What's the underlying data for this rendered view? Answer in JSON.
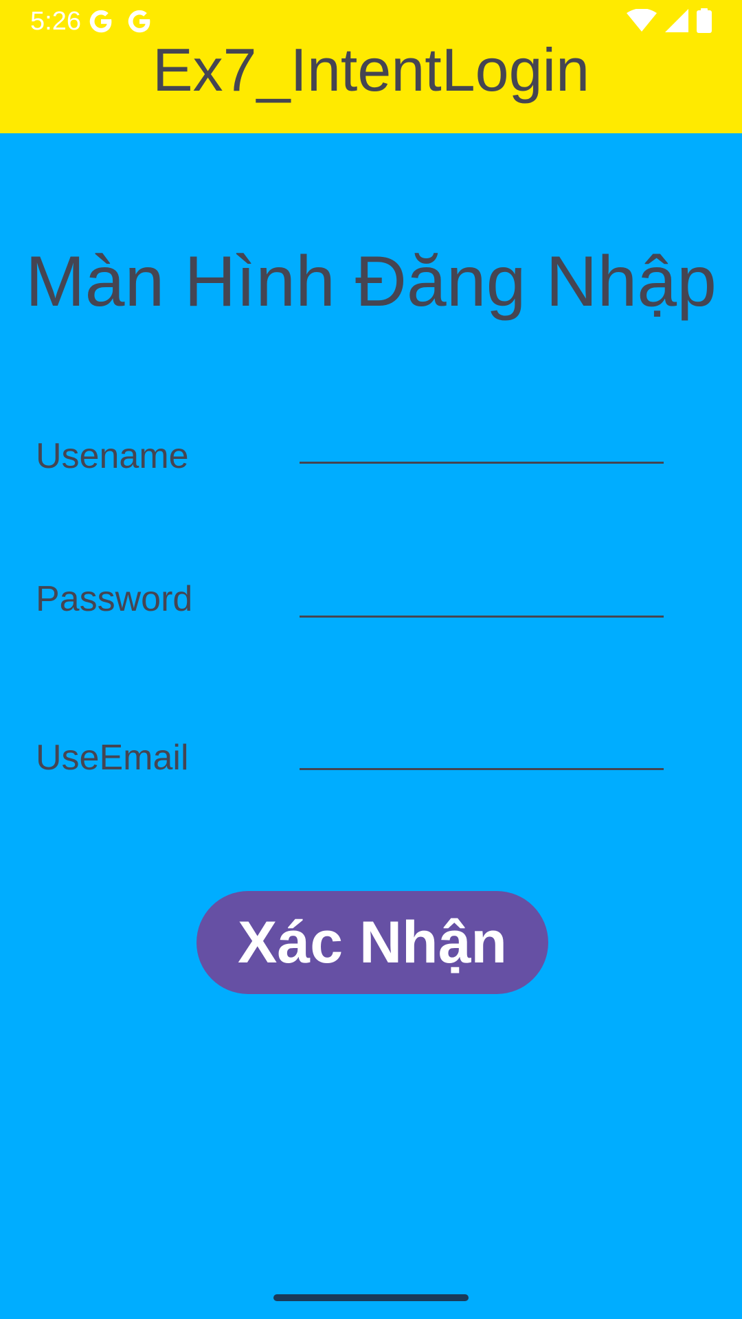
{
  "status_bar": {
    "time": "5:26",
    "icons": [
      "google-g-icon",
      "google-g-icon",
      "wifi-icon",
      "cell-signal-icon",
      "battery-icon"
    ]
  },
  "app_bar": {
    "title": "Ex7_IntentLogin",
    "background": "#ffea00"
  },
  "screen": {
    "background": "#00adff",
    "heading": "Màn Hình Đăng Nhập"
  },
  "form": {
    "username_label": "Usename",
    "username_value": "",
    "password_label": "Password",
    "password_value": "",
    "email_label": "UseEmail",
    "email_value": ""
  },
  "confirm_button": {
    "label": "Xác Nhận",
    "color": "#6650a4"
  }
}
